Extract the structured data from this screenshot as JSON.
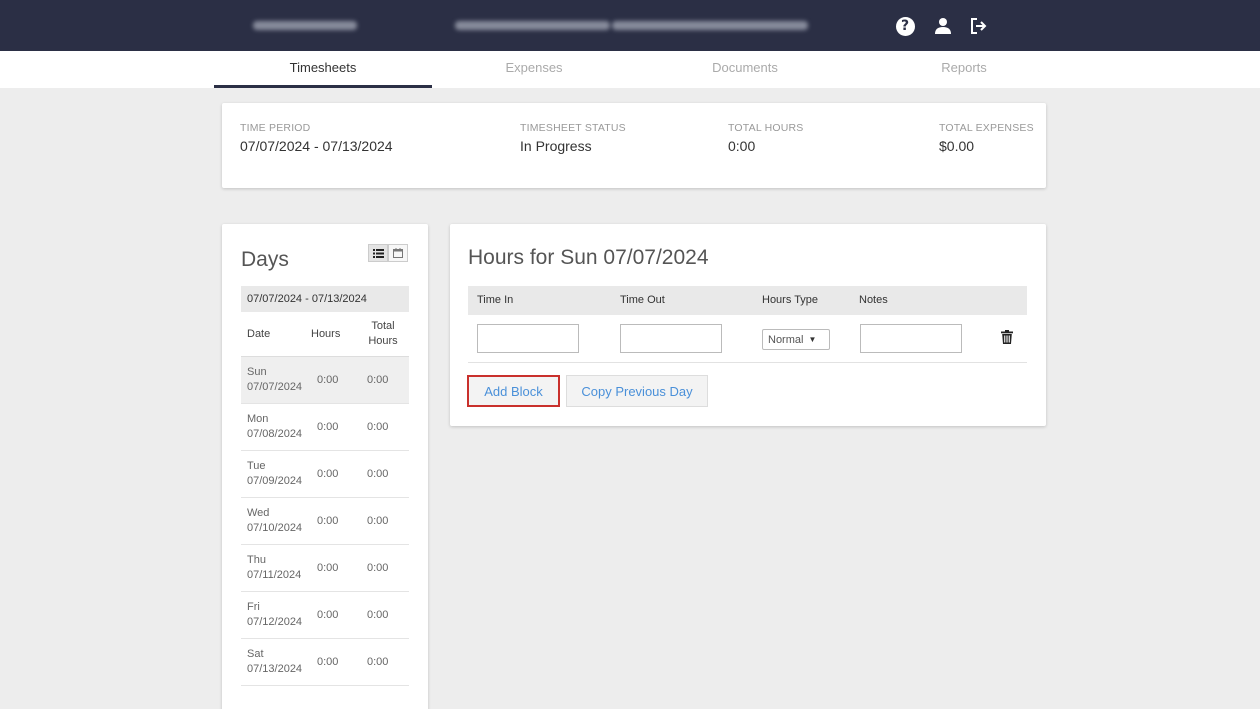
{
  "header": {
    "icons": [
      "help-icon",
      "user-icon",
      "logout-icon"
    ]
  },
  "tabs": [
    {
      "label": "Timesheets",
      "active": true
    },
    {
      "label": "Expenses",
      "active": false
    },
    {
      "label": "Documents",
      "active": false
    },
    {
      "label": "Reports",
      "active": false
    }
  ],
  "summary": {
    "period_label": "TIME PERIOD",
    "period_value": "07/07/2024 - 07/13/2024",
    "status_label": "TIMESHEET STATUS",
    "status_value": "In Progress",
    "hours_label": "TOTAL HOURS",
    "hours_value": "0:00",
    "expenses_label": "TOTAL EXPENSES",
    "expenses_value": "$0.00"
  },
  "days": {
    "title": "Days",
    "range": "07/07/2024 - 07/13/2024",
    "col_date": "Date",
    "col_hours": "Hours",
    "col_total_1": "Total",
    "col_total_2": "Hours",
    "rows": [
      {
        "day": "Sun",
        "date": "07/07/2024",
        "hours": "0:00",
        "total": "0:00"
      },
      {
        "day": "Mon",
        "date": "07/08/2024",
        "hours": "0:00",
        "total": "0:00"
      },
      {
        "day": "Tue",
        "date": "07/09/2024",
        "hours": "0:00",
        "total": "0:00"
      },
      {
        "day": "Wed",
        "date": "07/10/2024",
        "hours": "0:00",
        "total": "0:00"
      },
      {
        "day": "Thu",
        "date": "07/11/2024",
        "hours": "0:00",
        "total": "0:00"
      },
      {
        "day": "Fri",
        "date": "07/12/2024",
        "hours": "0:00",
        "total": "0:00"
      },
      {
        "day": "Sat",
        "date": "07/13/2024",
        "hours": "0:00",
        "total": "0:00"
      }
    ]
  },
  "hours_panel": {
    "title": "Hours for Sun 07/07/2024",
    "col_time_in": "Time In",
    "col_time_out": "Time Out",
    "col_hours_type": "Hours Type",
    "col_notes": "Notes",
    "time_in_value": "",
    "time_out_value": "",
    "notes_value": "",
    "hours_type_selected": "Normal",
    "add_block_label": "Add Block",
    "copy_previous_label": "Copy Previous Day"
  },
  "colors": {
    "topbar": "#2b2f45",
    "accent_link": "#4a90d9",
    "highlight_border": "#c9302c"
  }
}
